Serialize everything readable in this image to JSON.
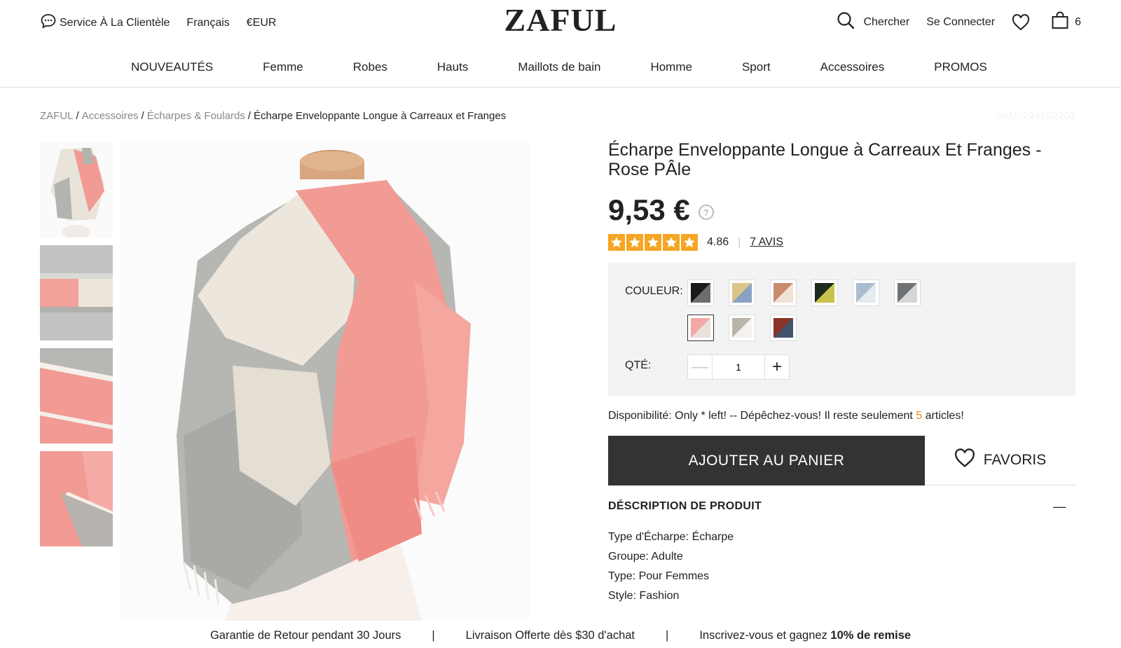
{
  "topbar": {
    "service_label": "Service À La Clientèle",
    "language": "Français",
    "currency": "€EUR",
    "logo": "ZAFUL",
    "search_label": "Chercher",
    "login_label": "Se Connecter",
    "cart_count": "6"
  },
  "nav": {
    "items": [
      {
        "label": "NOUVEAUTÉS"
      },
      {
        "label": "Femme"
      },
      {
        "label": "Robes"
      },
      {
        "label": "Hauts"
      },
      {
        "label": "Maillots de bain"
      },
      {
        "label": "Homme"
      },
      {
        "label": "Sport"
      },
      {
        "label": "Accessoires"
      },
      {
        "label": "PROMOS"
      }
    ]
  },
  "breadcrumb": {
    "items": [
      "ZAFUL",
      "Accessoires",
      "Écharpes & Foulards"
    ],
    "current": "Écharpe Enveloppante Longue à Carreaux et Franges",
    "separator": "/",
    "sku": "SKU: 224582203"
  },
  "product": {
    "title": "Écharpe Enveloppante Longue à Carreaux Et Franges - Rose PÂle",
    "price": "9,53 €",
    "help_icon_glyph": "?",
    "rating_value": "4.86",
    "rating_stars": 5,
    "rating_max": 5,
    "reviews_label": "7 AVIS",
    "color_label": "COULEUR:",
    "qty_label": "QTÉ:",
    "qty_value": "1",
    "qty_minus": "—",
    "qty_plus": "+",
    "availability_prefix": "Disponibilité: Only * left! -- Dépêchez-vous! Il reste seulement ",
    "availability_count": "5",
    "availability_suffix": " articles!",
    "add_to_cart_label": "AJOUTER AU PANIER",
    "favorite_label": "FAVORIS",
    "description_title": "DÉSCRIPTION DE PRODUIT",
    "description_toggle": "—",
    "description_items": [
      "Type d'Écharpe: Écharpe",
      "Groupe: Adulte",
      "Type: Pour Femmes",
      "Style: Fashion"
    ]
  },
  "swatches": [
    {
      "name": "black",
      "color_a": "#1a1a1a",
      "color_b": "#6d6d6d",
      "selected": false
    },
    {
      "name": "yellow-gray",
      "color_a": "#d9c48a",
      "color_b": "#8aa2c2",
      "selected": false
    },
    {
      "name": "tan",
      "color_a": "#c88c6f",
      "color_b": "#f0e3d6",
      "selected": false
    },
    {
      "name": "dark-green",
      "color_a": "#1e2a1e",
      "color_b": "#c8c24a",
      "selected": false
    },
    {
      "name": "blue-gray",
      "color_a": "#a9bcd0",
      "color_b": "#e4ebf1",
      "selected": false
    },
    {
      "name": "gray",
      "color_a": "#6f7275",
      "color_b": "#d4d6d8",
      "selected": false
    },
    {
      "name": "pink",
      "color_a": "#f1a9a4",
      "color_b": "#e8e1dc",
      "selected": true
    },
    {
      "name": "beige",
      "color_a": "#bab3aa",
      "color_b": "#f5f2ee",
      "selected": false
    },
    {
      "name": "red-brown",
      "color_a": "#8a3326",
      "color_b": "#44546a",
      "selected": false
    }
  ],
  "footer": {
    "item1": "Garantie de Retour pendant 30 Jours",
    "item2": "Livraison Offerte dès $30 d'achat",
    "item3_prefix": "Inscrivez-vous et gagnez ",
    "item3_bold": "10% de remise",
    "separator": "|"
  },
  "colors": {
    "accent": "#f08a24",
    "star": "#f5a623",
    "button_dark": "#333333",
    "scarf_pink": "#f29a94",
    "scarf_gray": "#b3b3b0",
    "scarf_cream": "#ece6dc"
  }
}
